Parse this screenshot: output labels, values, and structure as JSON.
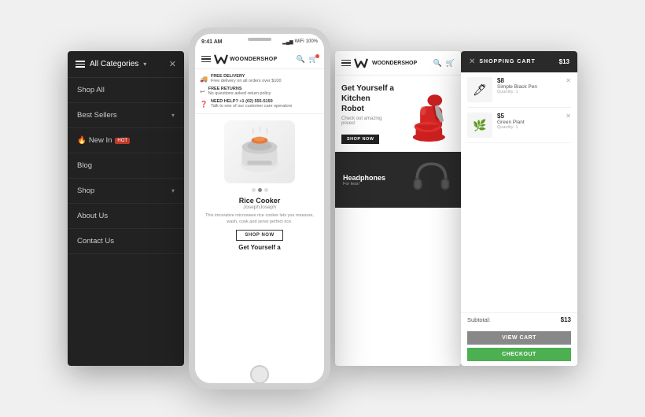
{
  "scene": {
    "bg": "#f0f0f0"
  },
  "menu": {
    "title": "All Categories",
    "items": [
      {
        "label": "Shop All",
        "hasArrow": false
      },
      {
        "label": "Best Sellers",
        "hasArrow": true
      },
      {
        "label": "New In",
        "badge": "HOT",
        "hasFire": true,
        "hasArrow": false
      },
      {
        "label": "Blog",
        "hasArrow": false
      },
      {
        "label": "Shop",
        "hasArrow": true
      },
      {
        "label": "About Us",
        "hasArrow": false
      },
      {
        "label": "Contact Us",
        "hasArrow": false
      }
    ]
  },
  "phone": {
    "time": "9:41 AM",
    "battery": "100%",
    "logo": "WOONDERSHOP",
    "info_bars": [
      {
        "icon": "🚚",
        "title": "FREE DELIVERY",
        "sub": "Free delivery on all orders over $100"
      },
      {
        "icon": "↩",
        "title": "FREE RETURNS",
        "sub": "No questions asked return policy"
      },
      {
        "icon": "?",
        "title": "NEED HELP? +1 (02) 555-5150",
        "sub": "Talk to one of our customer care operators"
      }
    ],
    "product": {
      "name": "Rice Cooker",
      "brand": "JosephJoseph",
      "desc": "This innovative microwave rice cooker lets you measure, wash, cook and serve perfect rice.",
      "shop_btn": "SHOP NOW"
    },
    "get_yourself": "Get Yourself a"
  },
  "shop": {
    "logo": "WOONDERSHOP",
    "hero": {
      "heading": "Get Yourself a Kitchen Robot",
      "subtext": "Check out amazing prices!",
      "btn": "SHOP NOW"
    },
    "headphones": {
      "heading": "Headphones",
      "subtext": "For less!"
    }
  },
  "cart": {
    "title": "SHOPPING CART",
    "total": "$13",
    "items": [
      {
        "price": "$8",
        "name": "Simple Black Pen",
        "qty": "Quantity: 1",
        "emoji": "🖊"
      },
      {
        "price": "$5",
        "name": "Green Plant",
        "qty": "Quantity: 1",
        "emoji": "🌿"
      }
    ],
    "subtotal_label": "Subtotal:",
    "subtotal_value": "$13",
    "view_cart_label": "VIEW CART",
    "checkout_label": "CHECKOUT"
  }
}
